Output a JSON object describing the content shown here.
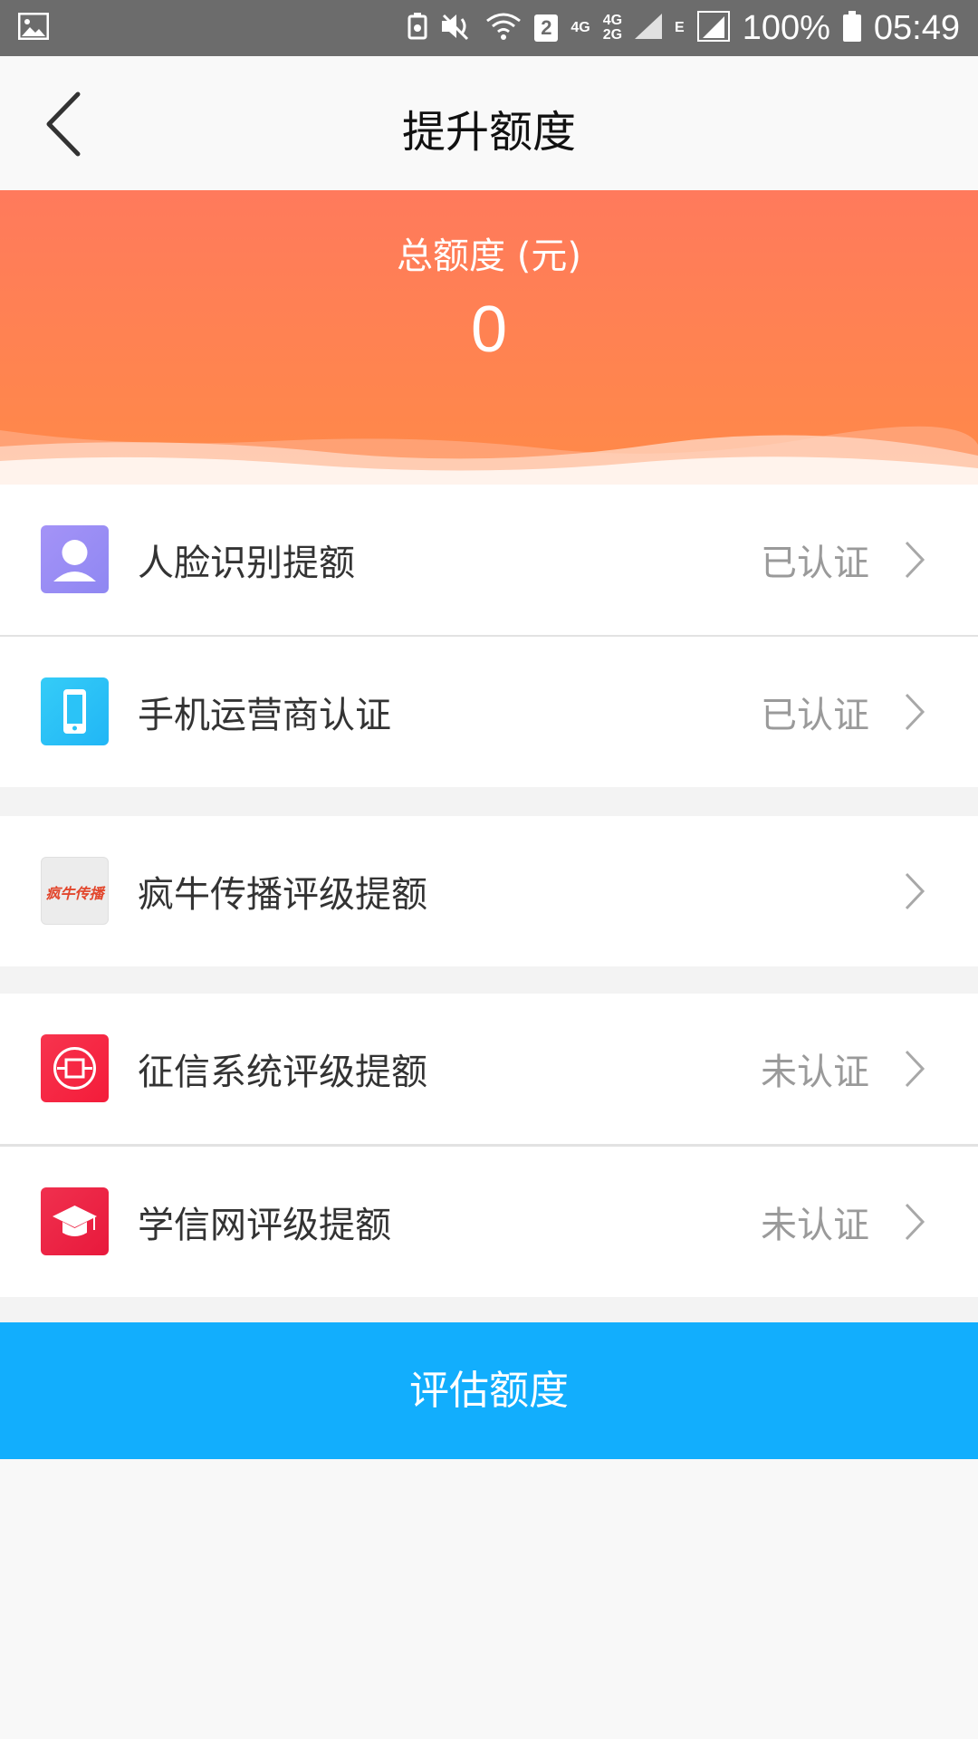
{
  "status_bar": {
    "gallery_icon": "image-icon",
    "net1": "4G",
    "net2_top": "4G",
    "net2_bottom": "2G",
    "sim_badge": "2",
    "edge": "E",
    "battery_percent": "100%",
    "time": "05:49"
  },
  "nav": {
    "title": "提升额度",
    "back_icon": "back-chevron-icon"
  },
  "header": {
    "total_label": "总额度 (元)",
    "total_value": "0",
    "gradient_top": "#ff7a5c",
    "gradient_bottom": "#ff8a48"
  },
  "items": [
    {
      "label": "人脸识别提额",
      "status": "已认证",
      "icon": "face-icon",
      "icon_color": "#9c8df5"
    },
    {
      "label": "手机运营商认证",
      "status": "已认证",
      "icon": "phone-icon",
      "icon_color": "#2bc3f7"
    },
    {
      "label": "疯牛传播评级提额",
      "status": "",
      "icon": "fengniu-logo-icon",
      "logo_text": "疯牛传播"
    },
    {
      "label": "征信系统评级提额",
      "status": "未认证",
      "icon": "credit-seal-icon",
      "icon_color": "#f41c3a"
    },
    {
      "label": "学信网评级提额",
      "status": "未认证",
      "icon": "graduation-cap-icon",
      "icon_color": "#ec2143"
    }
  ],
  "button": {
    "label": "评估额度",
    "color": "#12aefd"
  }
}
